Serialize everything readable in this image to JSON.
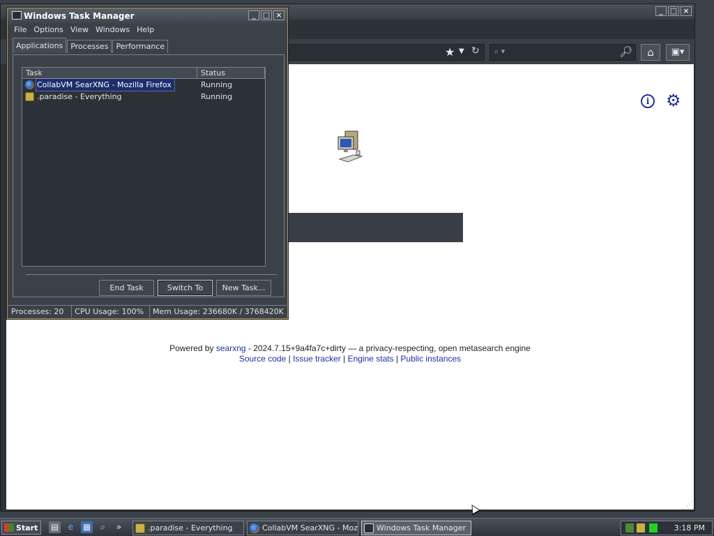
{
  "firefox": {
    "info_icon_glyph": "i",
    "footer": {
      "powered_by": "Powered by ",
      "searxng_link": "searxng",
      "version_text": " - 2024.7.15+9a4fa7c+dirty — a privacy-respecting, open metasearch engine",
      "links": [
        "Source code",
        "Issue tracker",
        "Engine stats",
        "Public instances"
      ],
      "separator": " | "
    },
    "accent_color": "#1d2fa6"
  },
  "taskmanager": {
    "title": "Windows Task Manager",
    "menu": [
      "File",
      "Options",
      "View",
      "Windows",
      "Help"
    ],
    "tabs": [
      "Applications",
      "Processes",
      "Performance"
    ],
    "active_tab": "Applications",
    "columns": {
      "task": "Task",
      "status": "Status"
    },
    "rows": [
      {
        "task": "CollabVM SearXNG - Mozilla Firefox",
        "status": "Running",
        "icon": "firefox-icon",
        "selected": true
      },
      {
        "task": ".paradise - Everything",
        "status": "Running",
        "icon": "everything-icon",
        "selected": false
      }
    ],
    "buttons": {
      "end_task": "End Task",
      "switch_to": "Switch To",
      "new_task": "New Task..."
    },
    "statusbar": {
      "processes": "Processes: 20",
      "cpu": "CPU Usage: 100%",
      "mem": "Mem Usage: 236680K / 3768420K"
    }
  },
  "taskbar": {
    "start_label": "Start",
    "quicklaunch_more": "»",
    "buttons": [
      {
        "label": ".paradise - Everything",
        "icon": "everything-icon",
        "active": false
      },
      {
        "label": "CollabVM SearXNG - Mozill...",
        "icon": "firefox-icon",
        "active": false
      },
      {
        "label": "Windows Task Manager",
        "icon": "taskmanager-icon",
        "active": true
      }
    ],
    "clock": "3:18 PM"
  }
}
